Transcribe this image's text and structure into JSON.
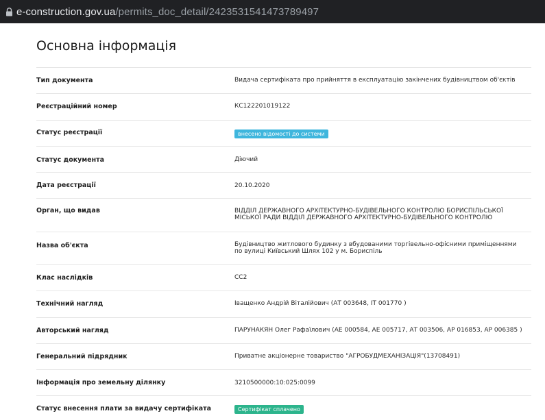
{
  "browser": {
    "url_host": "e-construction.gov.ua",
    "url_path": "/permits_doc_detail/2423531541473789497",
    "lock_icon": "lock-icon"
  },
  "page": {
    "title": "Основна інформація"
  },
  "rows": [
    {
      "label": "Тип документа",
      "value": "Видача сертифіката про прийняття в експлуатацію закінчених будівництвом об'єктів"
    },
    {
      "label": "Реєстраційний номер",
      "value": "КС122201019122"
    },
    {
      "label": "Статус реєстрації",
      "badge": "внесено відомості до системи",
      "badge_color": "#3fb6dd"
    },
    {
      "label": "Статус документа",
      "value": "Діючий"
    },
    {
      "label": "Дата реєстрації",
      "value": "20.10.2020"
    },
    {
      "label": "Орган, що видав",
      "value_lines": [
        "ВІДДІЛ ДЕРЖАВНОГО АРХІТЕКТУРНО-БУДІВЕЛЬНОГО КОНТРОЛЮ БОРИСПІЛЬСЬКОЇ",
        "МІСЬКОЇ РАДИ ВІДДІЛ ДЕРЖАВНОГО АРХІТЕКТУРНО-БУДІВЕЛЬНОГО КОНТРОЛЮ"
      ]
    },
    {
      "label": "Назва об'єкта",
      "value_lines": [
        "Будівництво житлового будинку з вбудованими торгівельно-офісними приміщеннями",
        "по вулиці Київський Шлях 102 у м. Бориспіль"
      ]
    },
    {
      "label": "Клас наслідків",
      "value": "СС2"
    },
    {
      "label": "Технічний нагляд",
      "value": "Іващенко Андрій Віталійович (АТ 003648, ІТ 001770 )"
    },
    {
      "label": "Авторський нагляд",
      "value": "ПАРУНАКЯН Олег Рафаїлович (АЕ 000584, АЕ 005717, АТ 003506, АР 016853, АР 006385 )"
    },
    {
      "label": "Генеральний підрядник",
      "value": "Приватне акціонерне товариство \"АГРОБУДМЕХАНІЗАЦІЯ\"(13708491)"
    },
    {
      "label": "Інформація про земельну ділянку",
      "value": "3210500000:10:025:0099"
    },
    {
      "label": "Статус внесення плати за видачу сертифіката",
      "badge": "Сертифікат сплачено",
      "badge_color": "#2cb48c"
    }
  ]
}
